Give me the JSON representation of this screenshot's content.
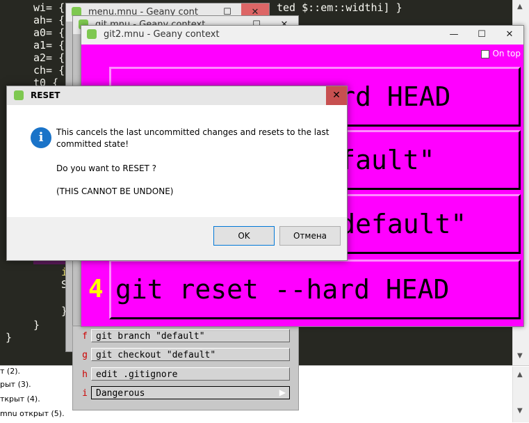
{
  "editor": {
    "lines": [
      {
        "text": "wi= {",
        "rest": "ted $::em::widthi] }"
      },
      {
        "text": "ah= {"
      },
      {
        "text": "a0= {"
      },
      {
        "text": "a1= {"
      },
      {
        "text": "a2= {"
      },
      {
        "text": "ch= {"
      },
      {
        "text": "t0 {"
      },
      {
        "text": "i"
      },
      {
        "text": "S"
      },
      {
        "text": "}"
      },
      {
        "text": "}"
      },
      {
        "text": "}"
      }
    ]
  },
  "messages": [
    "т (2).",
    "рыт (3).",
    "ткрыт (4).",
    "mnu открыт (5)."
  ],
  "windows": {
    "menu_title": "menu.mnu - Geany cont",
    "git_title": "git.mnu - Geany context",
    "git2_title": "git2.mnu - Geany context",
    "minimize": "—",
    "maximize": "☐",
    "close": "✕"
  },
  "git2": {
    "on_top_label": "On top",
    "buttons": [
      {
        "num": "",
        "text": "git reset --hard HEAD"
      },
      {
        "num": "",
        "text": "git branch \"default\""
      },
      {
        "num": "",
        "text": "git checkout \"default\""
      },
      {
        "num": "4",
        "text": "git reset --hard HEAD"
      }
    ]
  },
  "menu_list": [
    {
      "key": "f",
      "label": "git branch \"default\""
    },
    {
      "key": "g",
      "label": "git checkout \"default\""
    },
    {
      "key": "h",
      "label": "edit .gitignore"
    },
    {
      "key": "i",
      "label": "Dangerous"
    }
  ],
  "dialog": {
    "title": "RESET",
    "close": "✕",
    "info_glyph": "i",
    "line1": "This cancels the last uncommitted changes and resets to the last",
    "line2": "committed state!",
    "line3": "Do you want to RESET ?",
    "line4": "(THIS CANNOT BE UNDONE)",
    "ok": "OK",
    "cancel": "Отмена"
  }
}
